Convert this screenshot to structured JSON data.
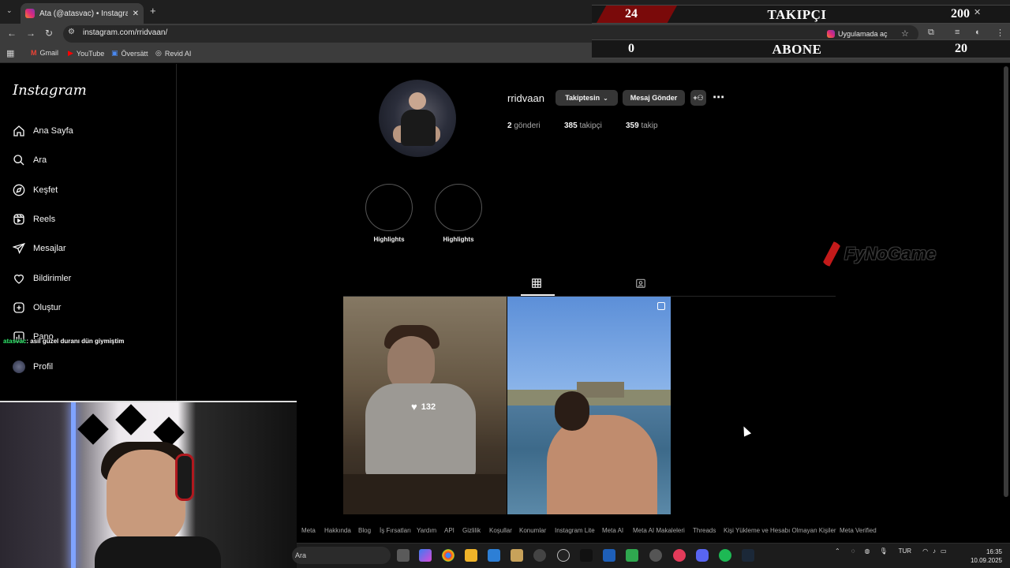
{
  "browser": {
    "tab_title": "Ata (@atasvac) • Instagram foto",
    "url": "instagram.com/rridvaan/",
    "open_in_app": "Uygulamada aç",
    "bookmarks": [
      "Gmail",
      "YouTube",
      "Översätt",
      "Revid AI"
    ]
  },
  "overlay_stats": {
    "followers": {
      "current": "24",
      "label": "TAKIPÇI",
      "goal": "200"
    },
    "subscribers": {
      "current": "0",
      "label": "ABONE",
      "goal": "20"
    }
  },
  "sidebar": {
    "logo": "Instagram",
    "items": [
      {
        "label": "Ana Sayfa",
        "icon": "home-icon"
      },
      {
        "label": "Ara",
        "icon": "search-icon"
      },
      {
        "label": "Keşfet",
        "icon": "compass-icon"
      },
      {
        "label": "Reels",
        "icon": "reels-icon"
      },
      {
        "label": "Mesajlar",
        "icon": "send-icon"
      },
      {
        "label": "Bildirimler",
        "icon": "heart-icon"
      },
      {
        "label": "Oluştur",
        "icon": "plus-square-icon"
      },
      {
        "label": "Pano",
        "icon": "dashboard-icon"
      },
      {
        "label": "Profil",
        "icon": "avatar-icon"
      }
    ]
  },
  "chat": {
    "user": "atasvac",
    "message": ": asil güzel duranı dün giymiştim"
  },
  "profile": {
    "username": "rridvaan",
    "follow_btn": "Takiptesin",
    "message_btn": "Mesaj Gönder",
    "posts_count": "2",
    "posts_label": "gönderi",
    "followers_count": "385",
    "followers_label": "takipçi",
    "following_count": "359",
    "following_label": "takip",
    "highlights": [
      "Highlights",
      "Highlights"
    ],
    "post1_likes": "132"
  },
  "watermark": "FyNoGame",
  "footer_links": [
    "Meta",
    "Hakkında",
    "Blog",
    "İş Fırsatları",
    "Yardım",
    "API",
    "Gizlilik",
    "Koşullar",
    "Konumlar",
    "Instagram Lite",
    "Meta AI",
    "Meta AI Makaleleri",
    "Threads",
    "Kişi Yükleme ve Hesabı Olmayan Kişiler",
    "Meta Verified"
  ],
  "taskbar": {
    "search": "Ara",
    "lang": "TUR",
    "time": "16:35",
    "date": "10.09.2025"
  }
}
